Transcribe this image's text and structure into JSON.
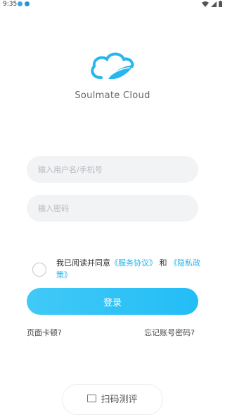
{
  "status_bar": {
    "time": "9:35"
  },
  "brand": {
    "name": "Soulmate Cloud"
  },
  "login_form": {
    "username_placeholder": "输入用户名/手机号",
    "password_placeholder": "输入密码"
  },
  "agreement": {
    "prefix": "我已阅读并同意",
    "service_link": "《服务协议》",
    "joiner": "和",
    "privacy_link": "《隐私政策》"
  },
  "actions": {
    "login_label": "登录",
    "page_stuck": "页面卡顿?",
    "forgot_password": "忘记账号密码?",
    "scan_test": "扫码测评"
  },
  "colors": {
    "accent": "#22bdf5",
    "field_bg": "#f2f3f5"
  }
}
